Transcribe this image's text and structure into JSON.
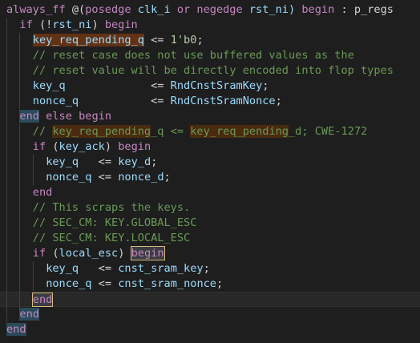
{
  "code": {
    "lines": [
      {
        "indent": 0,
        "tokens": [
          {
            "t": "always_ff",
            "c": "kw"
          },
          {
            "t": " @(",
            "c": "pl"
          },
          {
            "t": "posedge",
            "c": "kw"
          },
          {
            "t": " clk_i ",
            "c": "id"
          },
          {
            "t": "or",
            "c": "kw"
          },
          {
            "t": " ",
            "c": "pl"
          },
          {
            "t": "negedge",
            "c": "kw"
          },
          {
            "t": " rst_ni) ",
            "c": "id"
          },
          {
            "t": "begin",
            "c": "kw"
          },
          {
            "t": " : p_regs",
            "c": "pl"
          }
        ]
      },
      {
        "indent": 1,
        "tokens": [
          {
            "t": "if",
            "c": "kw"
          },
          {
            "t": " (!",
            "c": "pl"
          },
          {
            "t": "rst_ni",
            "c": "id"
          },
          {
            "t": ") ",
            "c": "pl"
          },
          {
            "t": "begin",
            "c": "kw"
          }
        ]
      },
      {
        "indent": 2,
        "tokens": [
          {
            "t": "key_req_pending_q",
            "c": "id",
            "h": "word"
          },
          {
            "t": " <= ",
            "c": "pl"
          },
          {
            "t": "1'b0",
            "c": "num"
          },
          {
            "t": ";",
            "c": "pl"
          }
        ]
      },
      {
        "indent": 2,
        "tokens": [
          {
            "t": "// reset case does not use buffered values as the",
            "c": "cm"
          }
        ]
      },
      {
        "indent": 2,
        "tokens": [
          {
            "t": "// reset value will be directly encoded into flop types",
            "c": "cm"
          }
        ]
      },
      {
        "indent": 2,
        "tokens": [
          {
            "t": "key_q",
            "c": "id"
          },
          {
            "t": "             <= ",
            "c": "pl"
          },
          {
            "t": "RndCnstSramKey",
            "c": "id"
          },
          {
            "t": ";",
            "c": "pl"
          }
        ]
      },
      {
        "indent": 2,
        "tokens": [
          {
            "t": "nonce_q",
            "c": "id"
          },
          {
            "t": "           <= ",
            "c": "pl"
          },
          {
            "t": "RndCnstSramNonce",
            "c": "id"
          },
          {
            "t": ";",
            "c": "pl"
          }
        ]
      },
      {
        "indent": 1,
        "tokens": [
          {
            "t": "end",
            "c": "kw",
            "h": "bracket"
          },
          {
            "t": " ",
            "c": "pl"
          },
          {
            "t": "else",
            "c": "kw"
          },
          {
            "t": " ",
            "c": "pl"
          },
          {
            "t": "begin",
            "c": "kw"
          }
        ]
      },
      {
        "indent": 2,
        "tokens": [
          {
            "t": "// ",
            "c": "cm"
          },
          {
            "t": "key_req_pending",
            "c": "cm",
            "h": "word-dim"
          },
          {
            "t": "_q <= ",
            "c": "cm"
          },
          {
            "t": "key_req_pending",
            "c": "cm",
            "h": "word-dim"
          },
          {
            "t": "_d; CWE-1272",
            "c": "cm"
          }
        ]
      },
      {
        "indent": 2,
        "tokens": [
          {
            "t": "if",
            "c": "kw"
          },
          {
            "t": " (",
            "c": "pl"
          },
          {
            "t": "key_ack",
            "c": "id"
          },
          {
            "t": ") ",
            "c": "pl"
          },
          {
            "t": "begin",
            "c": "kw"
          }
        ]
      },
      {
        "indent": 3,
        "tokens": [
          {
            "t": "key_q",
            "c": "id"
          },
          {
            "t": "   <= ",
            "c": "pl"
          },
          {
            "t": "key_d",
            "c": "id"
          },
          {
            "t": ";",
            "c": "pl"
          }
        ]
      },
      {
        "indent": 3,
        "tokens": [
          {
            "t": "nonce_q",
            "c": "id"
          },
          {
            "t": " <= ",
            "c": "pl"
          },
          {
            "t": "nonce_d",
            "c": "id"
          },
          {
            "t": ";",
            "c": "pl"
          }
        ]
      },
      {
        "indent": 2,
        "tokens": [
          {
            "t": "end",
            "c": "kw"
          }
        ]
      },
      {
        "indent": 2,
        "tokens": [
          {
            "t": "// This scraps the keys.",
            "c": "cm"
          }
        ]
      },
      {
        "indent": 2,
        "tokens": [
          {
            "t": "// SEC_CM: KEY.GLOBAL_ESC",
            "c": "cm"
          }
        ]
      },
      {
        "indent": 2,
        "tokens": [
          {
            "t": "// SEC_CM: KEY.LOCAL_ESC",
            "c": "cm"
          }
        ]
      },
      {
        "indent": 2,
        "tokens": [
          {
            "t": "if",
            "c": "kw"
          },
          {
            "t": " (",
            "c": "pl"
          },
          {
            "t": "local_esc",
            "c": "id"
          },
          {
            "t": ") ",
            "c": "pl"
          },
          {
            "t": "begin",
            "c": "kw",
            "h": "match"
          }
        ]
      },
      {
        "indent": 3,
        "tokens": [
          {
            "t": "key_q",
            "c": "id"
          },
          {
            "t": "   <= ",
            "c": "pl"
          },
          {
            "t": "cnst_sram_key",
            "c": "id"
          },
          {
            "t": ";",
            "c": "pl"
          }
        ]
      },
      {
        "indent": 3,
        "tokens": [
          {
            "t": "nonce_q",
            "c": "id"
          },
          {
            "t": " <= ",
            "c": "pl"
          },
          {
            "t": "cnst_sram_nonce",
            "c": "id"
          },
          {
            "t": ";",
            "c": "pl"
          }
        ]
      },
      {
        "indent": 2,
        "current": true,
        "tokens": [
          {
            "t": "end",
            "c": "kw",
            "h": "match"
          }
        ]
      },
      {
        "indent": 1,
        "tokens": [
          {
            "t": "end",
            "c": "kw",
            "h": "bracket"
          }
        ]
      },
      {
        "indent": 0,
        "tokens": [
          {
            "t": "end",
            "c": "kw",
            "h": "bracket"
          }
        ]
      }
    ]
  },
  "colors": {
    "background": "#1e1e1e",
    "keyword": "#c586c0",
    "comment": "#6a9955",
    "identifier": "#9cdcfe",
    "number": "#b5cea8",
    "word_highlight": "#613214"
  }
}
